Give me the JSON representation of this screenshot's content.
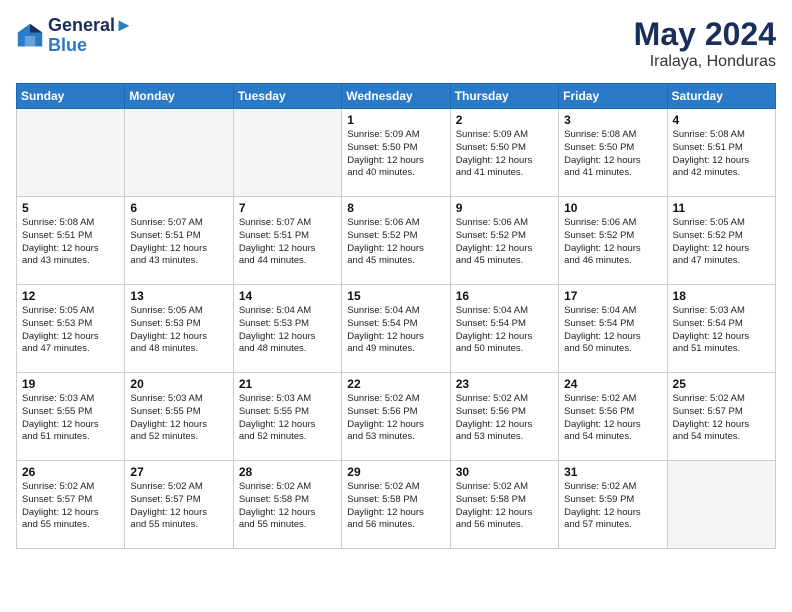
{
  "header": {
    "logo_line1": "General",
    "logo_line2": "Blue",
    "month_year": "May 2024",
    "location": "Iralaya, Honduras"
  },
  "weekdays": [
    "Sunday",
    "Monday",
    "Tuesday",
    "Wednesday",
    "Thursday",
    "Friday",
    "Saturday"
  ],
  "weeks": [
    [
      {
        "day": "",
        "info": ""
      },
      {
        "day": "",
        "info": ""
      },
      {
        "day": "",
        "info": ""
      },
      {
        "day": "1",
        "info": "Sunrise: 5:09 AM\nSunset: 5:50 PM\nDaylight: 12 hours\nand 40 minutes."
      },
      {
        "day": "2",
        "info": "Sunrise: 5:09 AM\nSunset: 5:50 PM\nDaylight: 12 hours\nand 41 minutes."
      },
      {
        "day": "3",
        "info": "Sunrise: 5:08 AM\nSunset: 5:50 PM\nDaylight: 12 hours\nand 41 minutes."
      },
      {
        "day": "4",
        "info": "Sunrise: 5:08 AM\nSunset: 5:51 PM\nDaylight: 12 hours\nand 42 minutes."
      }
    ],
    [
      {
        "day": "5",
        "info": "Sunrise: 5:08 AM\nSunset: 5:51 PM\nDaylight: 12 hours\nand 43 minutes."
      },
      {
        "day": "6",
        "info": "Sunrise: 5:07 AM\nSunset: 5:51 PM\nDaylight: 12 hours\nand 43 minutes."
      },
      {
        "day": "7",
        "info": "Sunrise: 5:07 AM\nSunset: 5:51 PM\nDaylight: 12 hours\nand 44 minutes."
      },
      {
        "day": "8",
        "info": "Sunrise: 5:06 AM\nSunset: 5:52 PM\nDaylight: 12 hours\nand 45 minutes."
      },
      {
        "day": "9",
        "info": "Sunrise: 5:06 AM\nSunset: 5:52 PM\nDaylight: 12 hours\nand 45 minutes."
      },
      {
        "day": "10",
        "info": "Sunrise: 5:06 AM\nSunset: 5:52 PM\nDaylight: 12 hours\nand 46 minutes."
      },
      {
        "day": "11",
        "info": "Sunrise: 5:05 AM\nSunset: 5:52 PM\nDaylight: 12 hours\nand 47 minutes."
      }
    ],
    [
      {
        "day": "12",
        "info": "Sunrise: 5:05 AM\nSunset: 5:53 PM\nDaylight: 12 hours\nand 47 minutes."
      },
      {
        "day": "13",
        "info": "Sunrise: 5:05 AM\nSunset: 5:53 PM\nDaylight: 12 hours\nand 48 minutes."
      },
      {
        "day": "14",
        "info": "Sunrise: 5:04 AM\nSunset: 5:53 PM\nDaylight: 12 hours\nand 48 minutes."
      },
      {
        "day": "15",
        "info": "Sunrise: 5:04 AM\nSunset: 5:54 PM\nDaylight: 12 hours\nand 49 minutes."
      },
      {
        "day": "16",
        "info": "Sunrise: 5:04 AM\nSunset: 5:54 PM\nDaylight: 12 hours\nand 50 minutes."
      },
      {
        "day": "17",
        "info": "Sunrise: 5:04 AM\nSunset: 5:54 PM\nDaylight: 12 hours\nand 50 minutes."
      },
      {
        "day": "18",
        "info": "Sunrise: 5:03 AM\nSunset: 5:54 PM\nDaylight: 12 hours\nand 51 minutes."
      }
    ],
    [
      {
        "day": "19",
        "info": "Sunrise: 5:03 AM\nSunset: 5:55 PM\nDaylight: 12 hours\nand 51 minutes."
      },
      {
        "day": "20",
        "info": "Sunrise: 5:03 AM\nSunset: 5:55 PM\nDaylight: 12 hours\nand 52 minutes."
      },
      {
        "day": "21",
        "info": "Sunrise: 5:03 AM\nSunset: 5:55 PM\nDaylight: 12 hours\nand 52 minutes."
      },
      {
        "day": "22",
        "info": "Sunrise: 5:02 AM\nSunset: 5:56 PM\nDaylight: 12 hours\nand 53 minutes."
      },
      {
        "day": "23",
        "info": "Sunrise: 5:02 AM\nSunset: 5:56 PM\nDaylight: 12 hours\nand 53 minutes."
      },
      {
        "day": "24",
        "info": "Sunrise: 5:02 AM\nSunset: 5:56 PM\nDaylight: 12 hours\nand 54 minutes."
      },
      {
        "day": "25",
        "info": "Sunrise: 5:02 AM\nSunset: 5:57 PM\nDaylight: 12 hours\nand 54 minutes."
      }
    ],
    [
      {
        "day": "26",
        "info": "Sunrise: 5:02 AM\nSunset: 5:57 PM\nDaylight: 12 hours\nand 55 minutes."
      },
      {
        "day": "27",
        "info": "Sunrise: 5:02 AM\nSunset: 5:57 PM\nDaylight: 12 hours\nand 55 minutes."
      },
      {
        "day": "28",
        "info": "Sunrise: 5:02 AM\nSunset: 5:58 PM\nDaylight: 12 hours\nand 55 minutes."
      },
      {
        "day": "29",
        "info": "Sunrise: 5:02 AM\nSunset: 5:58 PM\nDaylight: 12 hours\nand 56 minutes."
      },
      {
        "day": "30",
        "info": "Sunrise: 5:02 AM\nSunset: 5:58 PM\nDaylight: 12 hours\nand 56 minutes."
      },
      {
        "day": "31",
        "info": "Sunrise: 5:02 AM\nSunset: 5:59 PM\nDaylight: 12 hours\nand 57 minutes."
      },
      {
        "day": "",
        "info": ""
      }
    ]
  ]
}
